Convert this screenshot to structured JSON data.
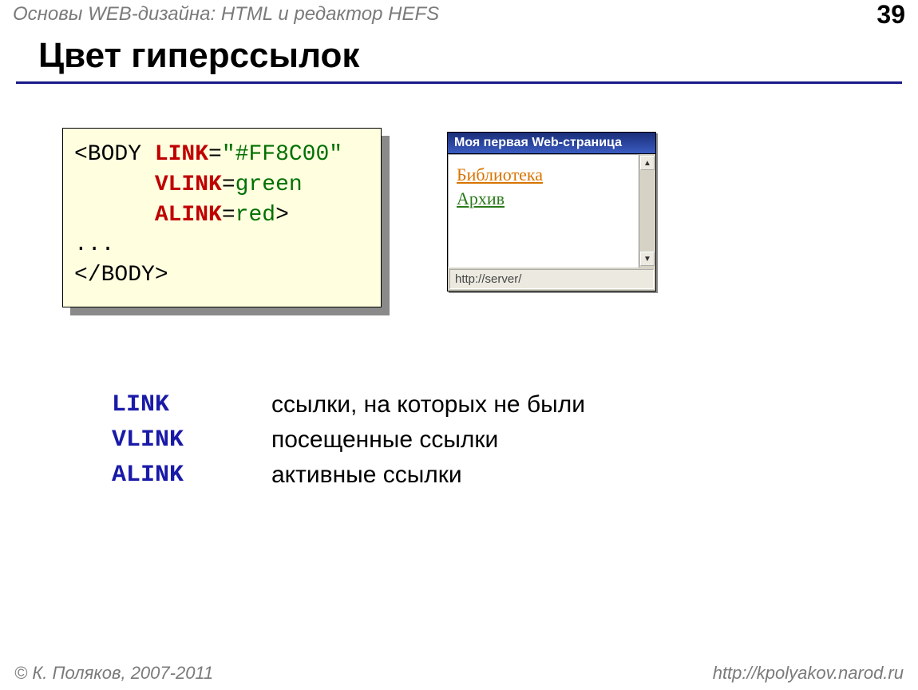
{
  "header": {
    "course": "Основы WEB-дизайна: HTML и редактор HEFS",
    "page": "39"
  },
  "title": "Цвет гиперссылок",
  "code": {
    "l1a": "<BODY ",
    "l1b": "LINK",
    "l1c": "=",
    "l1d": "\"#FF8C00\"",
    "l2a": "VLINK",
    "l2b": "=",
    "l2c": "green",
    "l3a": "ALINK",
    "l3b": "=",
    "l3c": "red",
    "l3d": ">",
    "l4": "...",
    "l5": "</BODY>"
  },
  "browser": {
    "title": "Моя первая Web-страница",
    "link1": "Библиотека",
    "link2": "Архив",
    "status": "http://server/"
  },
  "defs": [
    {
      "key": "LINK",
      "val": "ссылки, на которых не были"
    },
    {
      "key": "VLINK",
      "val": "посещенные ссылки"
    },
    {
      "key": "ALINK",
      "val": "активные ссылки"
    }
  ],
  "footer": {
    "left": "© К. Поляков, 2007-2011",
    "right": "http://kpolyakov.narod.ru"
  },
  "colors": {
    "link_color": "#FF8C00",
    "vlink_color": "green",
    "alink_color": "red"
  }
}
